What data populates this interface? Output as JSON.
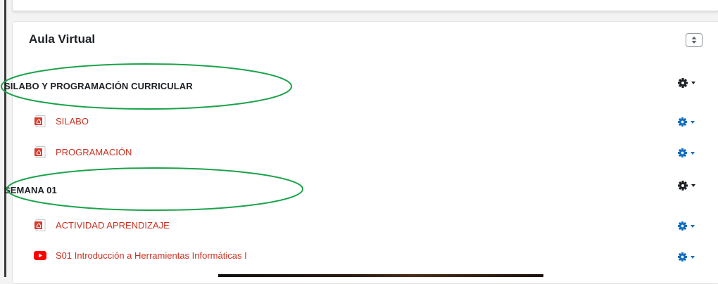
{
  "course": {
    "block_title": "Aula Virtual",
    "collapse_icon": "collapse-expand-icon",
    "sections": [
      {
        "title": "SILABO Y PROGRAMACIÓN CURRICULAR",
        "activities": [
          {
            "label": "SILABO",
            "icon": "pdf-icon"
          },
          {
            "label": "PROGRAMACIÓN",
            "icon": "pdf-icon"
          }
        ]
      },
      {
        "title": "SEMANA 01",
        "activities": [
          {
            "label": "ACTIVIDAD APRENDIZAJE",
            "icon": "pdf-icon"
          },
          {
            "label": "S01 Introducción a Herramientas Informáticas I",
            "icon": "youtube-icon"
          }
        ]
      }
    ]
  },
  "colors": {
    "link": "#ca3120",
    "section_gear": "#1d2125",
    "activity_gear": "#0f6cbf",
    "highlight_ellipse": "#1aa34a",
    "pdf_red": "#d83b2d",
    "youtube_red": "#ff0000"
  }
}
